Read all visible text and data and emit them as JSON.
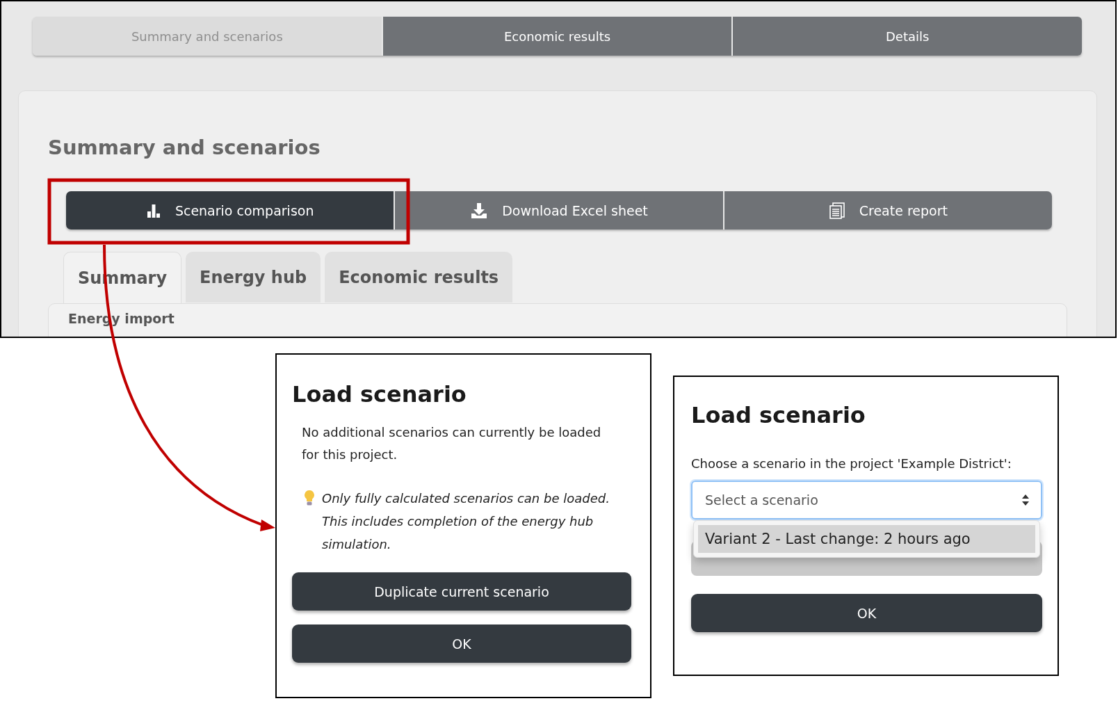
{
  "top_nav": {
    "tabs": [
      {
        "label": "Summary and scenarios",
        "selected": true
      },
      {
        "label": "Economic results",
        "selected": false
      },
      {
        "label": "Details",
        "selected": false
      }
    ]
  },
  "section": {
    "title": "Summary and scenarios",
    "actions": [
      {
        "label": "Scenario comparison",
        "kind": "chart",
        "selected": true
      },
      {
        "label": "Download Excel sheet",
        "kind": "download",
        "selected": false
      },
      {
        "label": "Create report",
        "kind": "report",
        "selected": false
      }
    ],
    "subtabs": [
      {
        "label": "Summary",
        "selected": true
      },
      {
        "label": "Energy hub",
        "selected": false
      },
      {
        "label": "Economic results",
        "selected": false
      }
    ],
    "content_heading": "Energy import"
  },
  "dialogs": [
    {
      "kind": "notice",
      "title": "Load scenario",
      "message": "No additional scenarios can currently be loaded for this project.",
      "hint": "Only fully calculated scenarios can be loaded. This includes completion of the energy hub simulation.",
      "buttons": [
        "Duplicate current scenario",
        "OK"
      ]
    },
    {
      "kind": "picker",
      "title": "Load scenario",
      "label": "Choose a scenario in the project 'Example District':",
      "select": {
        "placeholder": "Select a scenario"
      },
      "options": [
        {
          "label": "Variant 2 - Last change: 2 hours ago",
          "selected": true
        }
      ],
      "buttons": [
        "OK"
      ]
    }
  ]
}
